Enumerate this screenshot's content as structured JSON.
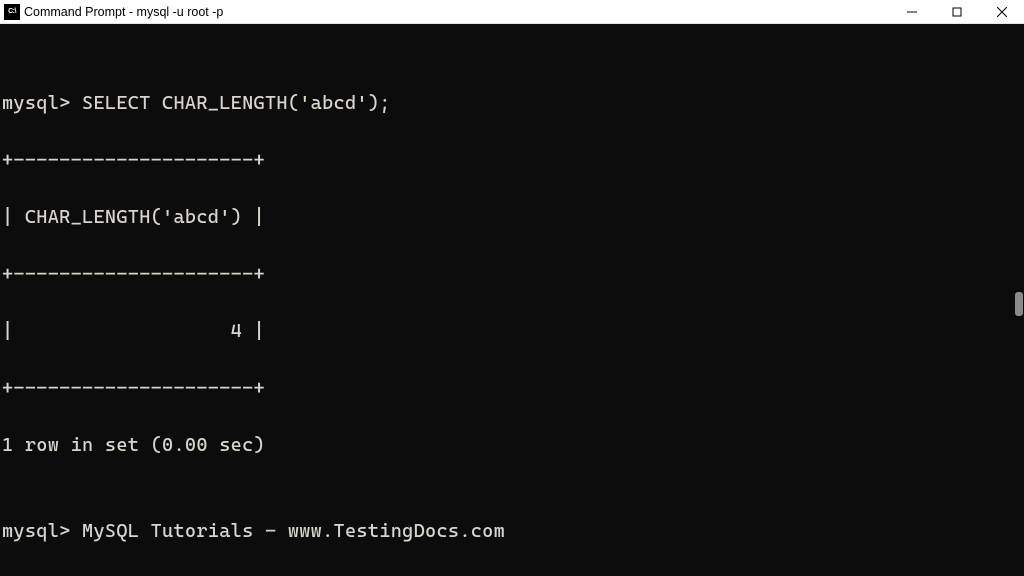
{
  "window": {
    "icon_label": "C:\\",
    "title": "Command Prompt - mysql  -u root -p"
  },
  "terminal": {
    "blank0": "",
    "line1_prompt": "mysql> ",
    "line1_cmd": "SELECT CHAR_LENGTH('abcd');",
    "line2": "+---------------------+",
    "line3": "| CHAR_LENGTH('abcd') |",
    "line4": "+---------------------+",
    "line5": "|                   4 |",
    "line6": "+---------------------+",
    "line7": "1 row in set (0.00 sec)",
    "blank1": "",
    "line8_prompt": "mysql> ",
    "line8_text": "MySQL Tutorials - www.TestingDocs.com"
  }
}
